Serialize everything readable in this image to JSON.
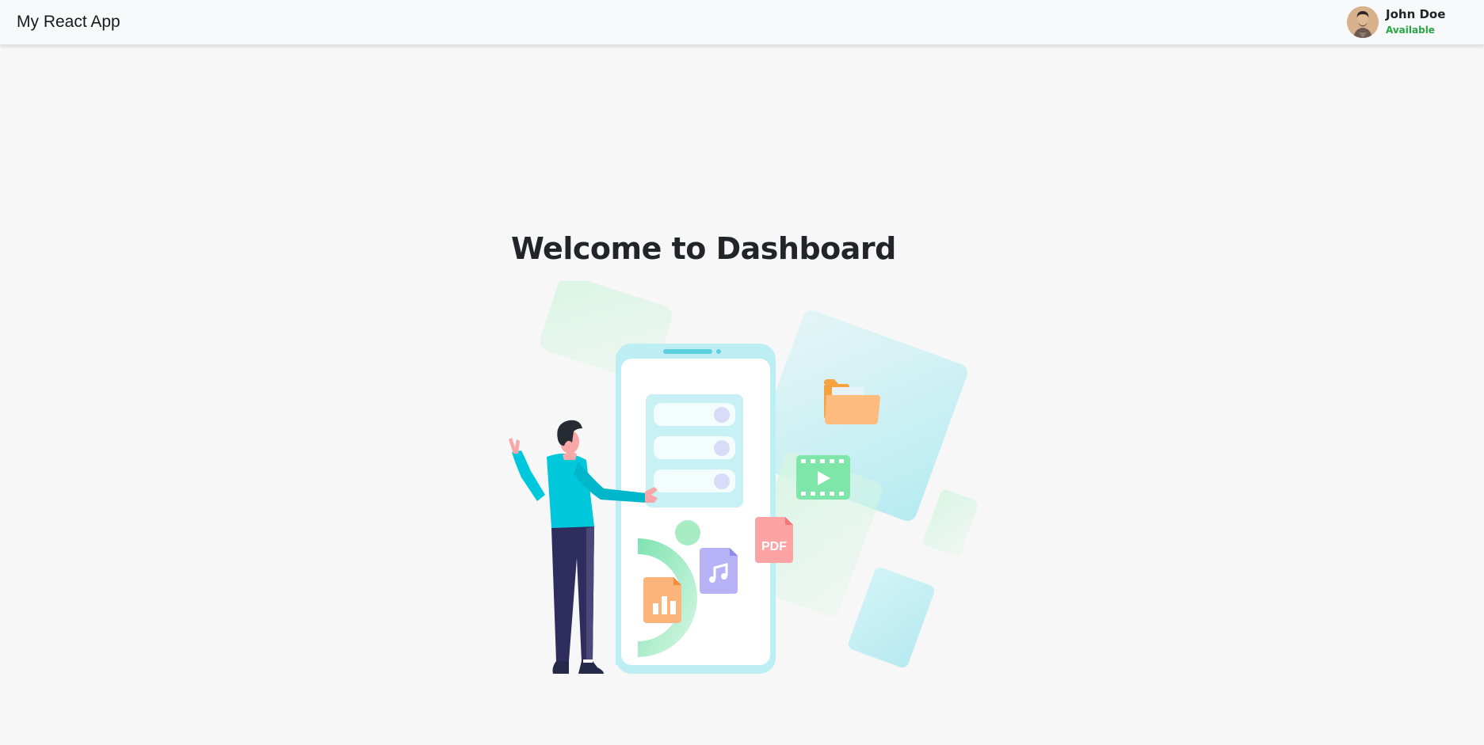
{
  "navbar": {
    "brand": "My React App",
    "user": {
      "name": "John Doe",
      "status": "Available",
      "status_color": "#28a745"
    }
  },
  "main": {
    "heading": "Welcome to Dashboard",
    "illustration": {
      "pdf_label": "PDF",
      "icons": [
        "folder-icon",
        "video-icon",
        "pdf-icon",
        "music-icon",
        "chart-file-icon"
      ]
    }
  },
  "colors": {
    "background": "#f7f7f7",
    "navbar": "#f8f9fa",
    "phone": "#bdeef3",
    "shirt": "#00c8dc",
    "pants": "#2f2d5e"
  }
}
